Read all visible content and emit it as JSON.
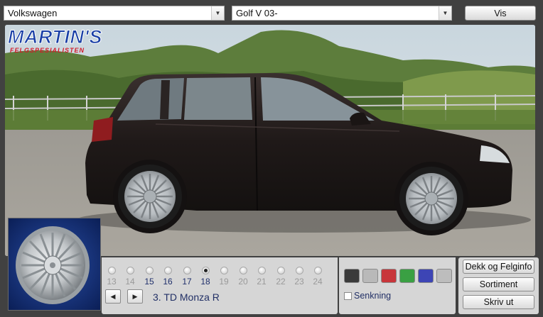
{
  "toolbar": {
    "make_select": {
      "value": "Volkswagen"
    },
    "model_select": {
      "value": "Golf V 03-"
    },
    "show_button": {
      "label": "Vis"
    }
  },
  "brand": {
    "logo_text": "MARTIN'S",
    "logo_subtext": "FELGSPESIALISTEN"
  },
  "rim_sizes": [
    {
      "size": "13",
      "available": false,
      "selected": false
    },
    {
      "size": "14",
      "available": false,
      "selected": false
    },
    {
      "size": "15",
      "available": true,
      "selected": false
    },
    {
      "size": "16",
      "available": true,
      "selected": false
    },
    {
      "size": "17",
      "available": true,
      "selected": false
    },
    {
      "size": "18",
      "available": true,
      "selected": true
    },
    {
      "size": "19",
      "available": false,
      "selected": false
    },
    {
      "size": "20",
      "available": false,
      "selected": false
    },
    {
      "size": "21",
      "available": false,
      "selected": false
    },
    {
      "size": "22",
      "available": false,
      "selected": false
    },
    {
      "size": "23",
      "available": false,
      "selected": false
    },
    {
      "size": "24",
      "available": false,
      "selected": false
    }
  ],
  "rim": {
    "name": "3. TD Monza R"
  },
  "nav": {
    "prev_icon": "arrow-left-icon",
    "next_icon": "arrow-right-icon"
  },
  "colors": [
    {
      "name": "black",
      "hex": "#3a3a3a"
    },
    {
      "name": "grey",
      "hex": "#b9b9b9"
    },
    {
      "name": "red",
      "hex": "#c8353a"
    },
    {
      "name": "green",
      "hex": "#3aa043"
    },
    {
      "name": "blue",
      "hex": "#3d45b5"
    },
    {
      "name": "light-grey",
      "hex": "#bdbdbd"
    }
  ],
  "lowering": {
    "label": "Senkning",
    "checked": false
  },
  "actions": {
    "tire_rim_info": "Dekk og Felginfo",
    "assortment": "Sortiment",
    "print": "Skriv ut"
  }
}
